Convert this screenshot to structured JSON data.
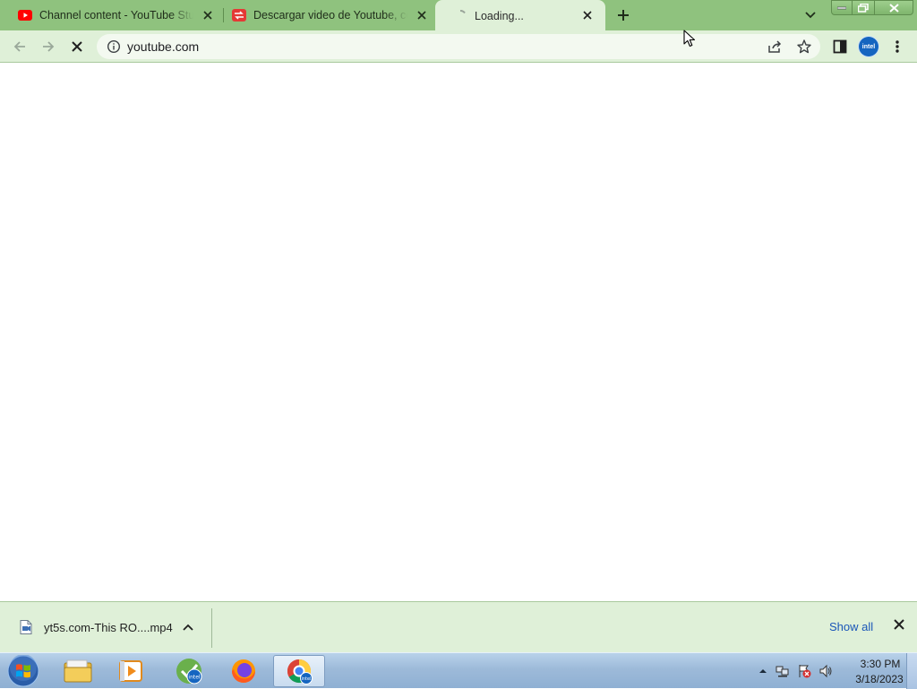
{
  "browser": {
    "tabs": [
      {
        "title": "Channel content - YouTube Studio",
        "favicon": "youtube-icon",
        "active": false
      },
      {
        "title": "Descargar video de Youtube, con",
        "favicon": "downloader-icon",
        "active": false
      },
      {
        "title": "Loading...",
        "favicon": "loading-spinner-icon",
        "active": true
      }
    ],
    "new_tab_icon": "plus-icon",
    "tab_search_icon": "chevron-down-icon"
  },
  "toolbar": {
    "back_icon": "arrow-left-icon",
    "forward_icon": "arrow-right-icon",
    "stop_icon": "close-icon",
    "url": "youtube.com",
    "site_info_icon": "info-icon",
    "share_icon": "share-icon",
    "bookmark_icon": "star-icon",
    "side_panel_icon": "side-panel-icon",
    "profile_label": "intel",
    "menu_icon": "kebab-menu-icon"
  },
  "download_shelf": {
    "item": {
      "filename": "yt5s.com-This RO....mp4",
      "icon": "video-file-icon"
    },
    "show_all_label": "Show all",
    "close_icon": "close-icon"
  },
  "taskbar": {
    "apps": [
      "windows-start-icon",
      "file-explorer-icon",
      "media-player-icon",
      "intel-app-icon",
      "firefox-icon",
      "chrome-icon"
    ],
    "clock": {
      "time": "3:30 PM",
      "date": "3/18/2023"
    }
  },
  "colors": {
    "tab_strip": "#8fc27e",
    "toolbar": "#dff0d8",
    "link": "#1a56b8",
    "taskbar": "#9dbad9"
  }
}
